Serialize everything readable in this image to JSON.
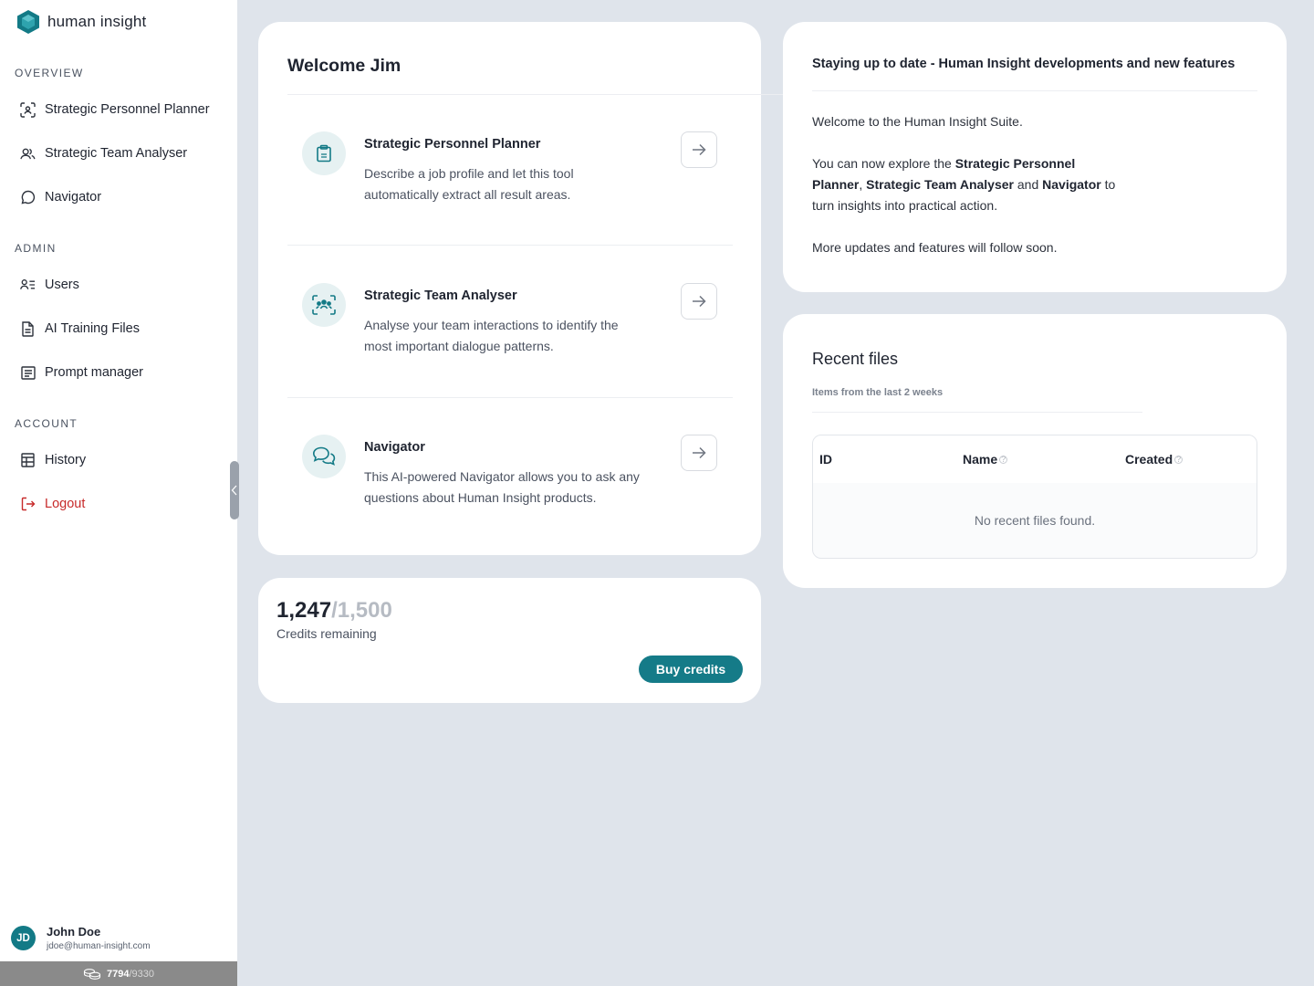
{
  "brand": {
    "name": "human insight",
    "logo_icon": "hexagon-logo-icon",
    "accent": "#137a86"
  },
  "sidebar": {
    "sections": [
      {
        "label": "OVERVIEW"
      },
      {
        "label": "ADMIN"
      },
      {
        "label": "ACCOUNT"
      }
    ],
    "items": [
      {
        "label": "Strategic Personnel Planner",
        "icon": "scan-person-icon"
      },
      {
        "label": "Strategic Team Analyser",
        "icon": "users-icon"
      },
      {
        "label": "Navigator",
        "icon": "chat-bubble-icon"
      },
      {
        "label": "Users",
        "icon": "user-list-icon"
      },
      {
        "label": "AI Training Files",
        "icon": "file-icon"
      },
      {
        "label": "Prompt manager",
        "icon": "list-box-icon"
      },
      {
        "label": "History",
        "icon": "table-icon"
      },
      {
        "label": "Logout",
        "icon": "logout-icon",
        "color": "#c72a2a"
      }
    ],
    "user": {
      "initials": "JD",
      "name": "John Doe",
      "email": "jdoe@human-insight.com"
    },
    "credits": {
      "used": "7794",
      "total": "/9330"
    }
  },
  "welcome": {
    "title": "Welcome Jim",
    "tools": [
      {
        "title": "Strategic Personnel Planner",
        "desc": "Describe a job profile and let this tool automatically extract all result areas.",
        "icon": "clipboard-icon"
      },
      {
        "title": "Strategic Team Analyser",
        "desc": "Analyse your team interactions to identify the most important dialogue patterns.",
        "icon": "team-scan-icon"
      },
      {
        "title": "Navigator",
        "desc": "This AI-powered Navigator allows you to ask any questions about Human Insight products.",
        "icon": "chat-bubbles-icon"
      }
    ]
  },
  "credits_card": {
    "remaining": "1,247",
    "total": "/1,500",
    "label": "Credits remaining",
    "buy_label": "Buy credits"
  },
  "news": {
    "title": "Staying up to date - Human Insight developments and  new features",
    "line1": "Welcome to the Human Insight Suite.",
    "line2_pre": "You can now explore the ",
    "spp": "Strategic Personnel Planner",
    "comma": ",",
    "sta": "Strategic Team Analyser",
    "and": " and ",
    "nav": "Navigator",
    "line2_post": " to turn insights into practical action.",
    "line3": "More updates and features will follow soon."
  },
  "recent_files": {
    "title": "Recent files",
    "subtitle": "Items from the last 2 weeks",
    "columns": [
      {
        "label": "ID"
      },
      {
        "label": "Name",
        "help": "?"
      },
      {
        "label": "Created",
        "help": "?"
      }
    ],
    "empty": "No recent files found."
  }
}
